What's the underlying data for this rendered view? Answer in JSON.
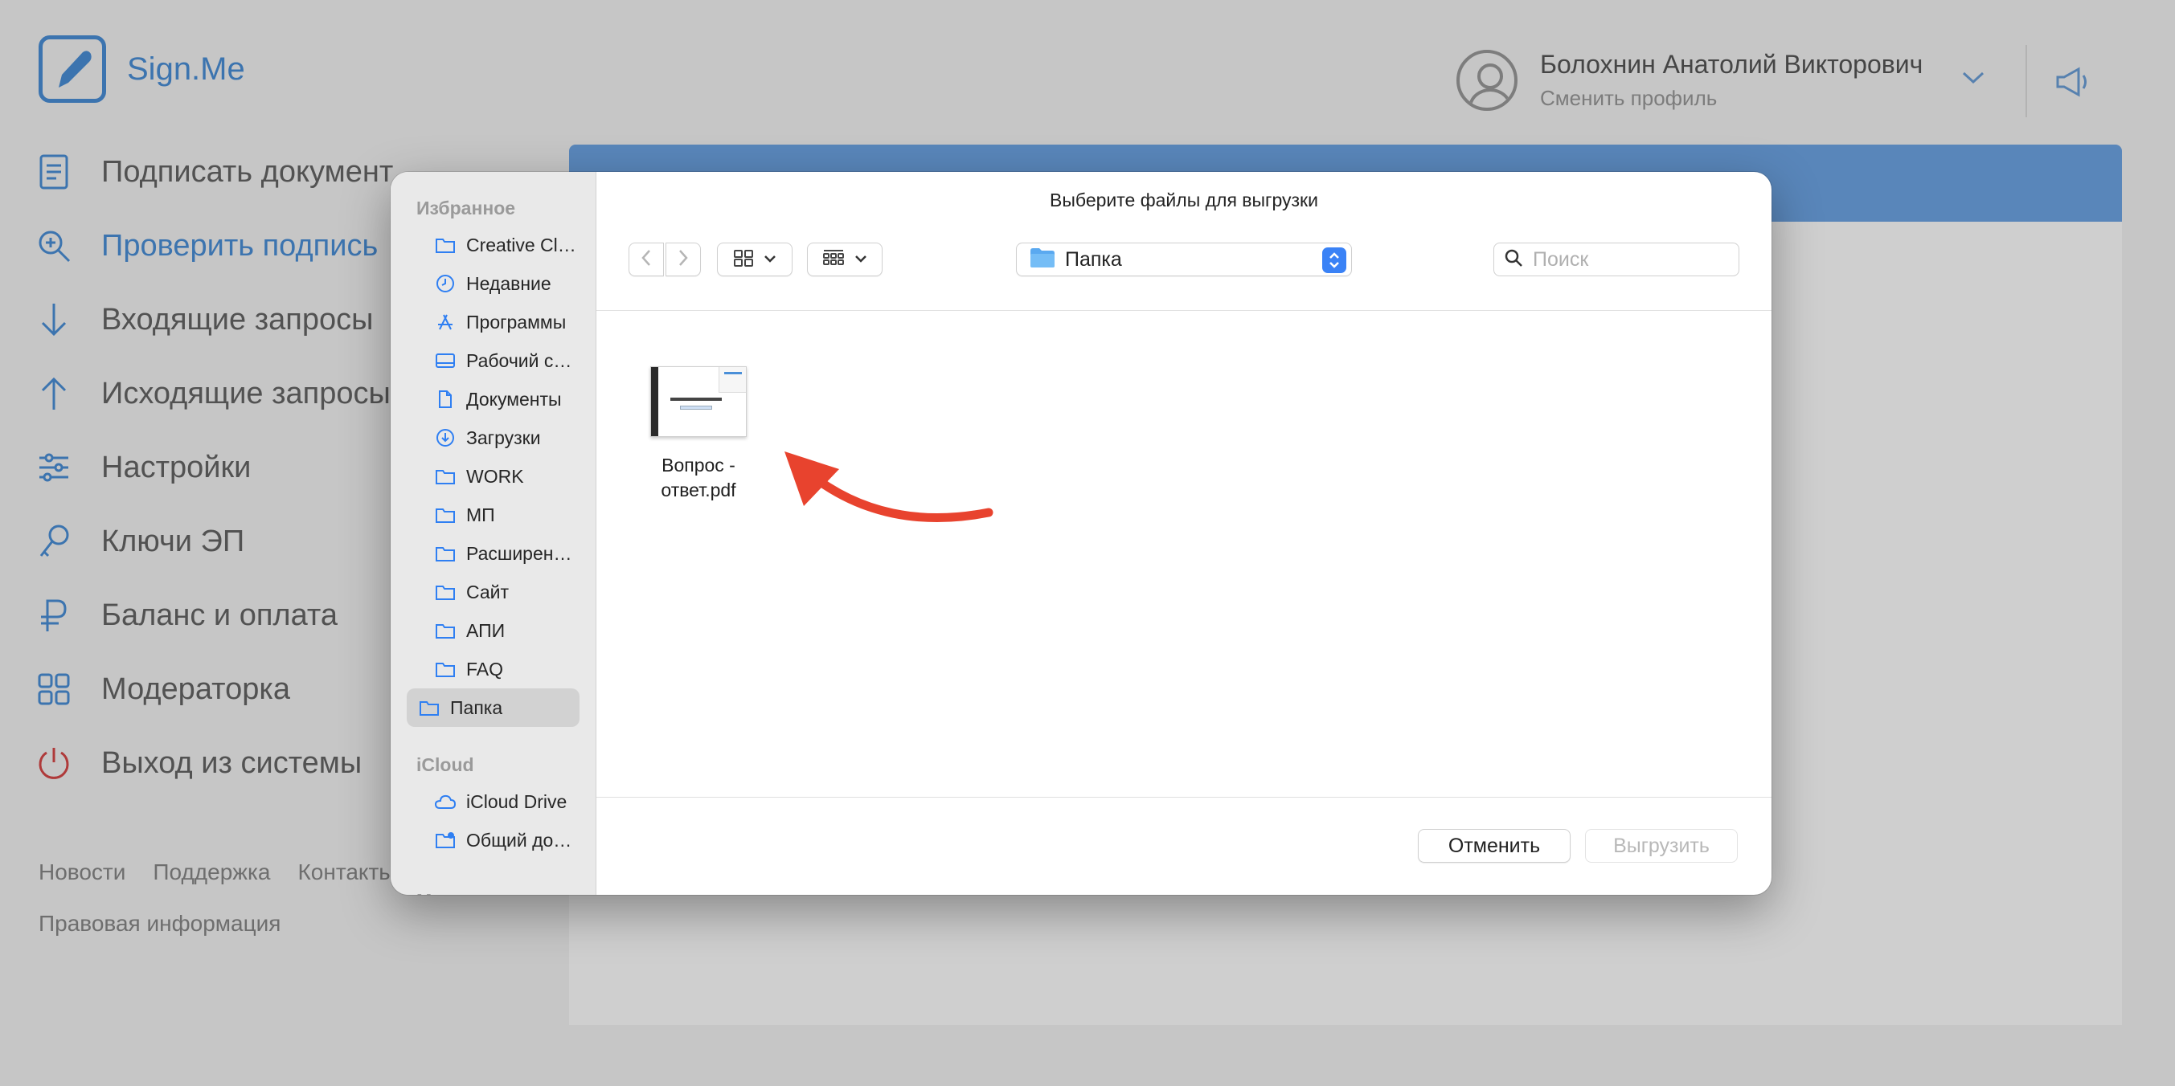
{
  "app": {
    "logo_text": "Sign.Me",
    "nav": [
      {
        "label": "Подписать документ",
        "icon": "document-icon"
      },
      {
        "label": "Проверить подпись",
        "icon": "search-check-icon",
        "active": true
      },
      {
        "label": "Входящие запросы",
        "icon": "arrow-down-icon"
      },
      {
        "label": "Исходящие запросы",
        "icon": "arrow-up-icon"
      },
      {
        "label": "Настройки",
        "icon": "sliders-icon"
      },
      {
        "label": "Ключи ЭП",
        "icon": "key-icon"
      },
      {
        "label": "Баланс и оплата",
        "icon": "ruble-icon"
      },
      {
        "label": "Модераторка",
        "icon": "grid-icon"
      },
      {
        "label": "Выход из системы",
        "icon": "power-icon"
      }
    ],
    "footer": {
      "news": "Новости",
      "support": "Поддержка",
      "contacts": "Контакты",
      "legal": "Правовая информация"
    },
    "user": {
      "name": "Болохнин Анатолий Викторович",
      "switch_profile": "Сменить профиль"
    }
  },
  "dialog": {
    "title": "Выберите файлы для выгрузки",
    "sidebar": {
      "favorites_header": "Избранное",
      "favorites": [
        {
          "label": "Creative Cloud Files",
          "icon": "folder-icon"
        },
        {
          "label": "Недавние",
          "icon": "clock-icon"
        },
        {
          "label": "Программы",
          "icon": "apps-icon"
        },
        {
          "label": "Рабочий стол",
          "icon": "desktop-icon"
        },
        {
          "label": "Документы",
          "icon": "doc-icon"
        },
        {
          "label": "Загрузки",
          "icon": "download-icon"
        },
        {
          "label": "WORK",
          "icon": "folder-icon"
        },
        {
          "label": "МП",
          "icon": "folder-icon"
        },
        {
          "label": "Расширенная",
          "icon": "folder-icon"
        },
        {
          "label": "Сайт",
          "icon": "folder-icon"
        },
        {
          "label": "АПИ",
          "icon": "folder-icon"
        },
        {
          "label": "FAQ",
          "icon": "folder-icon"
        },
        {
          "label": "Папка",
          "icon": "folder-icon",
          "selected": true
        }
      ],
      "icloud_header": "iCloud",
      "icloud": [
        {
          "label": "iCloud Drive",
          "icon": "cloud-icon"
        },
        {
          "label": "Общий доступ",
          "icon": "shared-folder-icon"
        }
      ],
      "places_header": "Места"
    },
    "location": "Папка",
    "search_placeholder": "Поиск",
    "files": [
      {
        "name": "Вопрос - ответ.pdf",
        "type": "pdf"
      }
    ],
    "cancel_label": "Отменить",
    "upload_label": "Выгрузить",
    "accent_color": "#3a82f6",
    "annotation_arrow_color": "#e8432e"
  }
}
